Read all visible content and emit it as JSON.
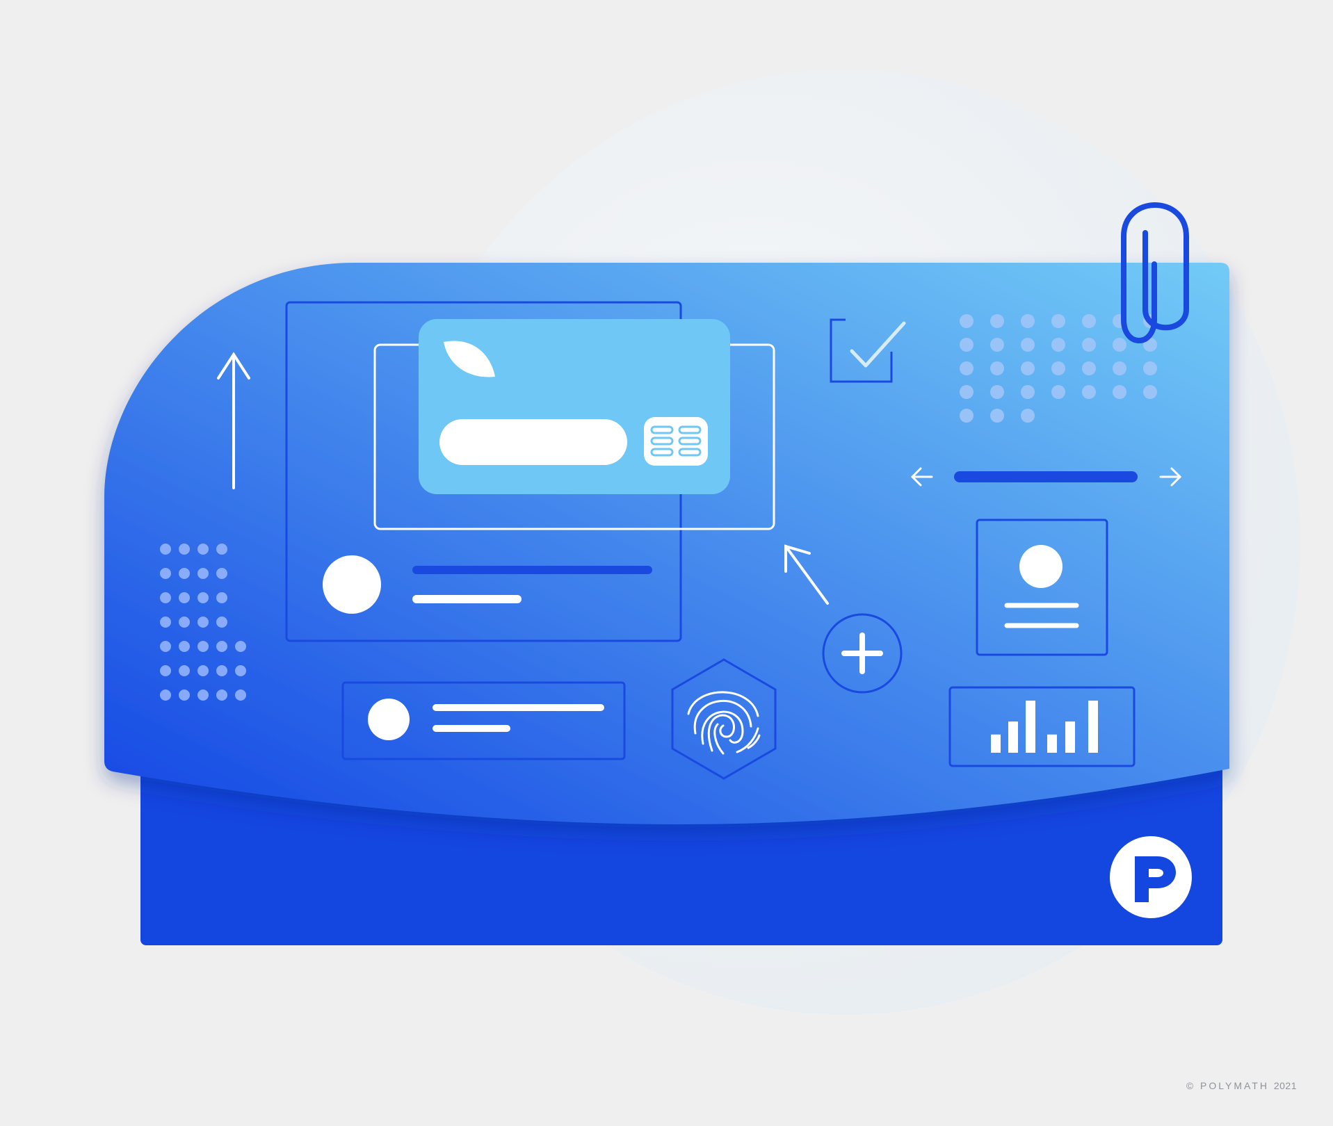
{
  "footer": {
    "brand": "© POLYMATH",
    "year": "2021"
  },
  "colors": {
    "background": "#efefef",
    "panel_dark": "#1446e0",
    "panel_gradient_start": "#1549e4",
    "panel_gradient_end": "#70c8f6",
    "card_light": "#6fc7f6",
    "white": "#ffffff",
    "line_blue": "#1a49e0",
    "dot": "#9ab8ff",
    "paperclip": "#1a49e0"
  },
  "icons": [
    "up-arrow-icon",
    "checkmark-icon",
    "paperclip-icon",
    "left-arrow-icon",
    "right-arrow-icon",
    "diagonal-arrow-icon",
    "plus-icon",
    "fingerprint-icon",
    "profile-card-icon",
    "bar-chart-icon",
    "polymath-logo"
  ],
  "bar_chart_levels": [
    0.35,
    0.6,
    1.0,
    0.35,
    0.6,
    1.0
  ]
}
